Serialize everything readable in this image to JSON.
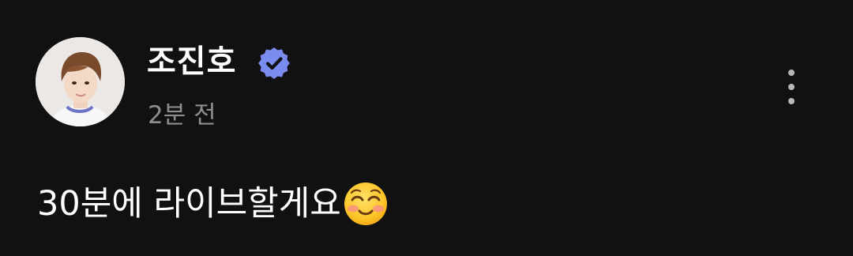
{
  "post": {
    "author": {
      "name": "조진호",
      "avatar_icon": "profile-photo",
      "verified": true,
      "badge_icon": "verified-badge-icon",
      "badge_color": "#7b8cf0"
    },
    "time": "2분 전",
    "more_icon": "more-vertical-icon",
    "text": "30분에 라이브할게요",
    "emoji_icon": "smiling-face-icon",
    "colors": {
      "background": "#111111",
      "primary_text": "#ffffff",
      "secondary_text": "#8e8e8e"
    }
  }
}
